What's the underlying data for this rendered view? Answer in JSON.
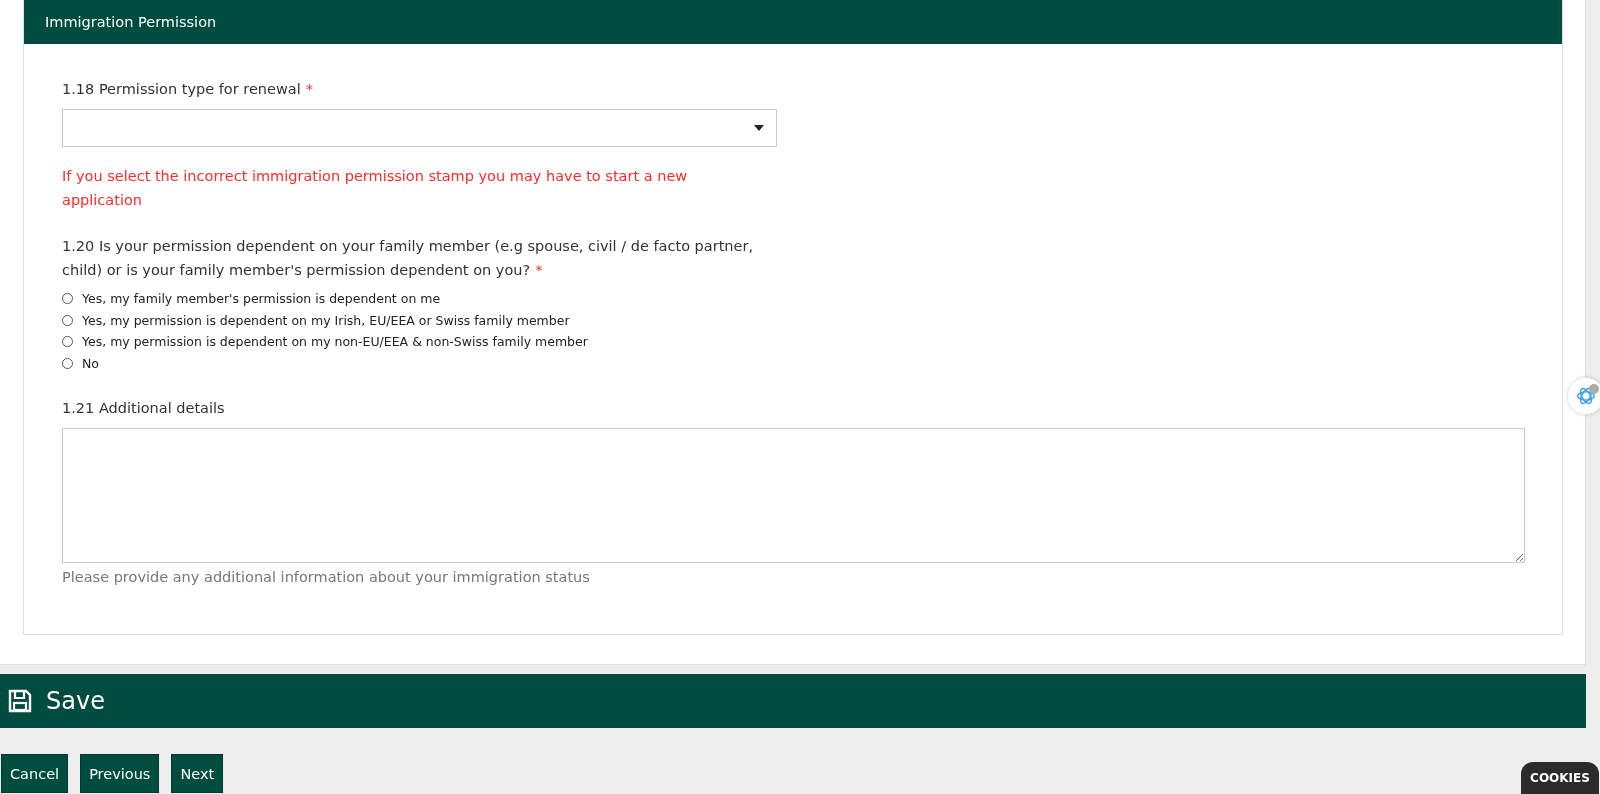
{
  "section": {
    "title": "Immigration Permission"
  },
  "permission_type": {
    "label": "1.18 Permission type for renewal",
    "required_mark": "*"
  },
  "warning": "If you select the incorrect immigration permission stamp you may have to start a new application",
  "dependency": {
    "label": "1.20 Is your permission dependent on your family member (e.g spouse, civil / de facto partner, child) or is your family member's permission dependent on you?",
    "required_mark": "*",
    "options": [
      {
        "label": "Yes, my family member's permission is dependent on me",
        "selected": false
      },
      {
        "label": "Yes, my permission is dependent on my Irish, EU/EEA or Swiss family member",
        "selected": false
      },
      {
        "label": "Yes, my permission is dependent on my non-EU/EEA & non-Swiss family member",
        "selected": false
      },
      {
        "label": "No",
        "selected": false
      }
    ]
  },
  "additional": {
    "label": "1.21 Additional details",
    "hint": "Please provide any additional information about your immigration status"
  },
  "save_bar": {
    "label": "Save"
  },
  "buttons": [
    "Cancel",
    "Previous",
    "Next"
  ],
  "cookies": "COOKIES"
}
